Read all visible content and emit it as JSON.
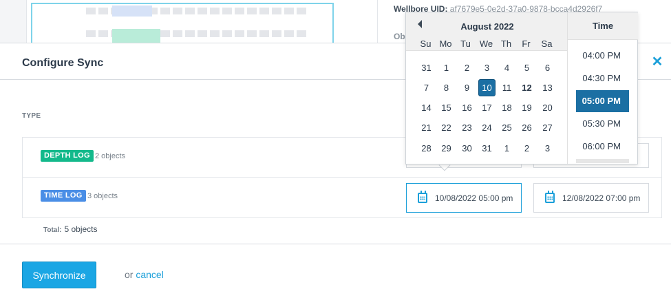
{
  "background": {
    "wellbore_uid_label": "Wellbore UID:",
    "wellbore_uid_value": "af7679e5-0e2d-37a0-9878-bcca4d2926f7",
    "obj_label": "Ob"
  },
  "modal": {
    "title": "Configure Sync",
    "close_icon": "close-icon",
    "type_label": "TYPE",
    "rows": [
      {
        "tag": "DEPTH LOG",
        "tag_color": "#13b98b",
        "count": "2 objects"
      },
      {
        "tag": "TIME LOG",
        "tag_color": "#4a8ee6",
        "count": "3 objects",
        "start_date": "10/08/2022 05:00 pm",
        "end_date": "12/08/2022 07:00 pm"
      }
    ],
    "total_label": "Total:",
    "total_value": "5 objects",
    "synchronize_label": "Synchronize",
    "or_text": "or",
    "cancel_label": "cancel"
  },
  "datepicker": {
    "month": "August 2022",
    "weekdays": [
      "Su",
      "Mo",
      "Tu",
      "We",
      "Th",
      "Fr",
      "Sa"
    ],
    "weeks": [
      [
        "31",
        "1",
        "2",
        "3",
        "4",
        "5",
        "6"
      ],
      [
        "7",
        "8",
        "9",
        "10",
        "11",
        "12",
        "13"
      ],
      [
        "14",
        "15",
        "16",
        "17",
        "18",
        "19",
        "20"
      ],
      [
        "21",
        "22",
        "23",
        "24",
        "25",
        "26",
        "27"
      ],
      [
        "28",
        "29",
        "30",
        "31",
        "1",
        "2",
        "3"
      ]
    ],
    "selected_day": "10",
    "today": "12",
    "time_header": "Time",
    "times": [
      "04:00 PM",
      "04:30 PM",
      "05:00 PM",
      "05:30 PM",
      "06:00 PM"
    ],
    "selected_time": "05:00 PM"
  },
  "colors": {
    "accent": "#1aa6e4",
    "selected": "#1b6fa3"
  }
}
